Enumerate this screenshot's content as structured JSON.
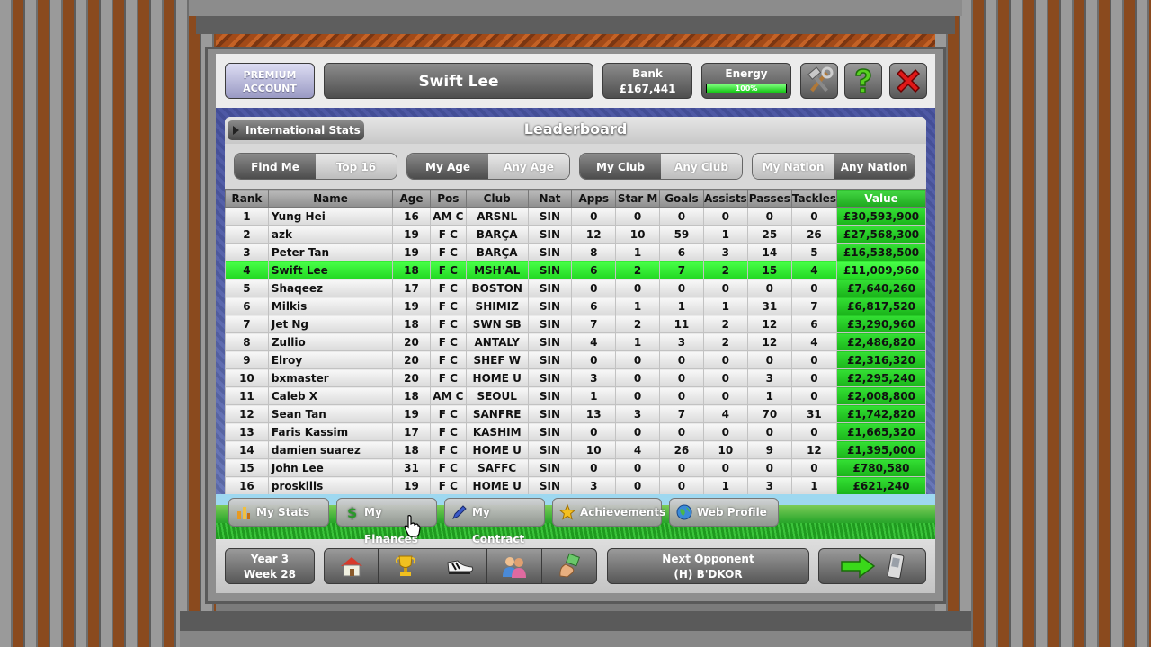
{
  "account": {
    "premium_line1": "PREMIUM",
    "premium_line2": "ACCOUNT",
    "player_name": "Swift Lee",
    "bank_label": "Bank",
    "bank_value": "£167,441",
    "energy_label": "Energy",
    "energy_value": "100%",
    "energy_fraction": 1.0
  },
  "header_icons": {
    "tools": "tools-icon",
    "help": "help-icon",
    "close": "close-icon"
  },
  "section": {
    "intl_stats_label": "International Stats",
    "title": "Leaderboard"
  },
  "filters": {
    "group1": [
      "Find Me",
      "Top 16"
    ],
    "group2": [
      "My Age",
      "Any Age"
    ],
    "group3": [
      "My Club",
      "Any Club"
    ],
    "group4": [
      "My Nation",
      "Any Nation"
    ],
    "selected": [
      "Find Me",
      "My Age",
      "My Club",
      "Any Nation"
    ]
  },
  "table": {
    "columns": [
      "Rank",
      "Name",
      "Age",
      "Pos",
      "Club",
      "Nat",
      "Apps",
      "Star M",
      "Goals",
      "Assists",
      "Passes",
      "Tackles",
      "Value"
    ],
    "rows": [
      [
        "1",
        "Yung Hei",
        "16",
        "AM C",
        "ARSNL",
        "SIN",
        "0",
        "0",
        "0",
        "0",
        "0",
        "0",
        "£30,593,900"
      ],
      [
        "2",
        "azk",
        "19",
        "F C",
        "BARÇA",
        "SIN",
        "12",
        "10",
        "59",
        "1",
        "25",
        "26",
        "£27,568,300"
      ],
      [
        "3",
        "Peter Tan",
        "19",
        "F C",
        "BARÇA",
        "SIN",
        "8",
        "1",
        "6",
        "3",
        "14",
        "5",
        "£16,538,500"
      ],
      [
        "4",
        "Swift Lee",
        "18",
        "F C",
        "MSH'AL",
        "SIN",
        "6",
        "2",
        "7",
        "2",
        "15",
        "4",
        "£11,009,960"
      ],
      [
        "5",
        "Shaqeez",
        "17",
        "F C",
        "BOSTON",
        "SIN",
        "0",
        "0",
        "0",
        "0",
        "0",
        "0",
        "£7,640,260"
      ],
      [
        "6",
        "Milkis",
        "19",
        "F C",
        "SHIMIZ",
        "SIN",
        "6",
        "1",
        "1",
        "1",
        "31",
        "7",
        "£6,817,520"
      ],
      [
        "7",
        "Jet Ng",
        "18",
        "F C",
        "SWN SB",
        "SIN",
        "7",
        "2",
        "11",
        "2",
        "12",
        "6",
        "£3,290,960"
      ],
      [
        "8",
        "Zullio",
        "20",
        "F C",
        "ANTALY",
        "SIN",
        "4",
        "1",
        "3",
        "2",
        "12",
        "4",
        "£2,486,820"
      ],
      [
        "9",
        "Elroy",
        "20",
        "F C",
        "SHEF W",
        "SIN",
        "0",
        "0",
        "0",
        "0",
        "0",
        "0",
        "£2,316,320"
      ],
      [
        "10",
        "bxmaster",
        "20",
        "F C",
        "HOME U",
        "SIN",
        "3",
        "0",
        "0",
        "0",
        "3",
        "0",
        "£2,295,240"
      ],
      [
        "11",
        "Caleb X",
        "18",
        "AM C",
        "SEOUL",
        "SIN",
        "1",
        "0",
        "0",
        "0",
        "1",
        "0",
        "£2,008,800"
      ],
      [
        "12",
        "Sean Tan",
        "19",
        "F C",
        "SANFRE",
        "SIN",
        "13",
        "3",
        "7",
        "4",
        "70",
        "31",
        "£1,742,820"
      ],
      [
        "13",
        "Faris Kassim",
        "17",
        "F C",
        "KASHIM",
        "SIN",
        "0",
        "0",
        "0",
        "0",
        "0",
        "0",
        "£1,665,320"
      ],
      [
        "14",
        "damien suarez",
        "18",
        "F C",
        "HOME U",
        "SIN",
        "10",
        "4",
        "26",
        "10",
        "9",
        "12",
        "£1,395,000"
      ],
      [
        "15",
        "John Lee",
        "31",
        "F C",
        "SAFFC",
        "SIN",
        "0",
        "0",
        "0",
        "0",
        "0",
        "0",
        "£780,580"
      ],
      [
        "16",
        "proskills",
        "19",
        "F C",
        "HOME U",
        "SIN",
        "3",
        "0",
        "0",
        "1",
        "3",
        "1",
        "£621,240"
      ]
    ],
    "highlight_rank": "4"
  },
  "tabs": [
    {
      "label": "My Stats",
      "icon": "stats-icon"
    },
    {
      "label": "My Finances",
      "icon": "dollar-icon"
    },
    {
      "label": "My Contract",
      "icon": "pen-icon"
    },
    {
      "label": "Achievements",
      "icon": "star-icon"
    },
    {
      "label": "Web Profile",
      "icon": "globe-icon"
    }
  ],
  "footer": {
    "year": "Year 3",
    "week": "Week 28",
    "nav_icons": [
      "home-icon",
      "trophy-icon",
      "boot-icon",
      "people-icon",
      "money-hand-icon"
    ],
    "next_opponent_label": "Next Opponent",
    "next_opponent_value": "(H) B'DKOR",
    "continue_icons": [
      "green-arrow-icon",
      "phone-icon"
    ]
  },
  "colors": {
    "highlight_row": "#33ee33",
    "value_column": "#22c022",
    "close_red": "#e01818"
  }
}
